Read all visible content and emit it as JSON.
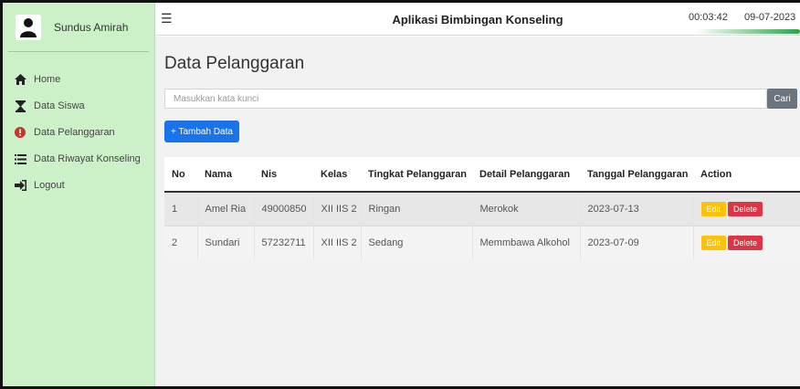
{
  "sidebar": {
    "user_name": "Sundus Amirah",
    "items": [
      {
        "label": "Home",
        "icon": "home-icon"
      },
      {
        "label": "Data Siswa",
        "icon": "hourglass-icon"
      },
      {
        "label": "Data Pelanggaran",
        "icon": "exclamation-icon"
      },
      {
        "label": "Data Riwayat Konseling",
        "icon": "list-icon"
      },
      {
        "label": "Logout",
        "icon": "logout-icon"
      }
    ]
  },
  "header": {
    "title": "Aplikasi Bimbingan Konseling",
    "time": "00:03:42",
    "date": "09-07-2023"
  },
  "main": {
    "page_title": "Data Pelanggaran",
    "search_placeholder": "Masukkan kata kunci",
    "search_button": "Cari",
    "add_button": "+ Tambah Data",
    "table": {
      "columns": [
        "No",
        "Nama",
        "Nis",
        "Kelas",
        "Tingkat Pelanggaran",
        "Detail Pelanggaran",
        "Tanggal Pelanggaran",
        "Action"
      ],
      "rows": [
        {
          "no": "1",
          "nama": "Amel Ria",
          "nis": "49000850",
          "kelas": "XII IIS 2",
          "tingkat": "Ringan",
          "detail": "Merokok",
          "tanggal": "2023-07-13"
        },
        {
          "no": "2",
          "nama": "Sundari",
          "nis": "57232711",
          "kelas": "XII IIS 2",
          "tingkat": "Sedang",
          "detail": "Memmbawa Alkohol",
          "tanggal": "2023-07-09"
        }
      ],
      "edit_label": "Edit",
      "delete_label": "Delete"
    }
  },
  "colors": {
    "sidebar_bg": "#ccf1c9",
    "primary": "#1a73e8",
    "edit": "#ffc107",
    "delete": "#dc3545",
    "secondary": "#6c757d"
  }
}
